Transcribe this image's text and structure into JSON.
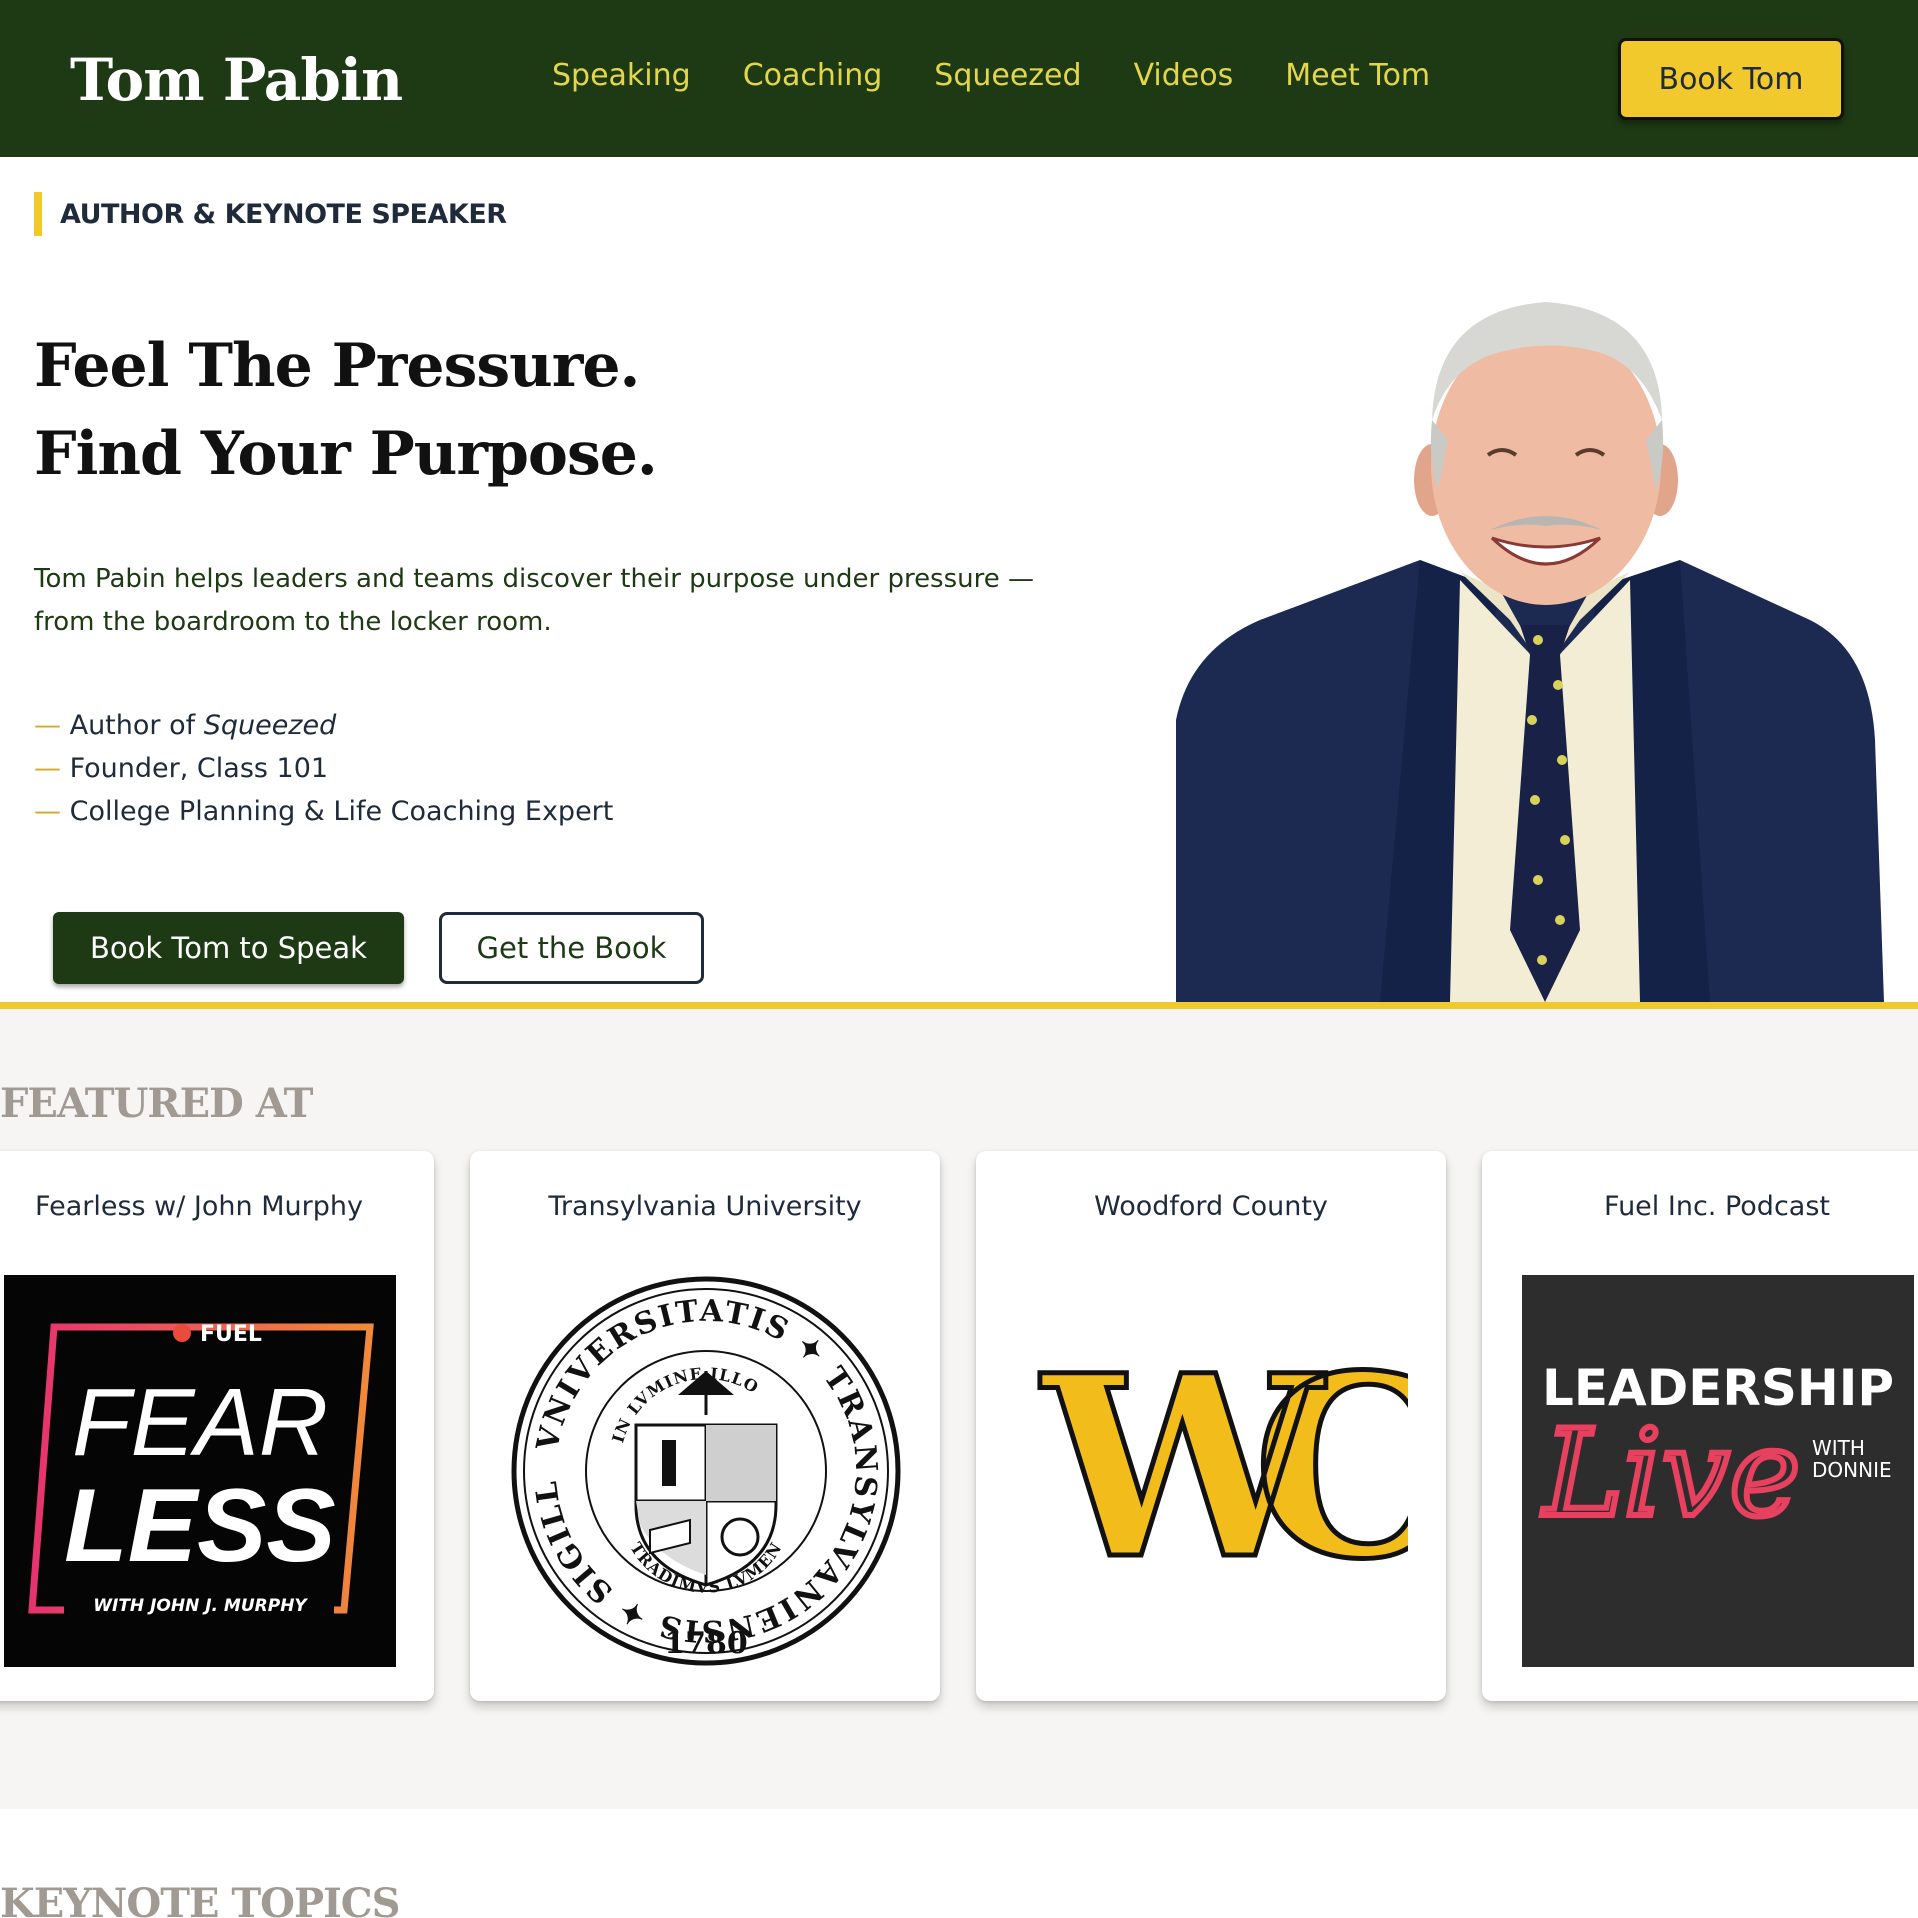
{
  "brand": "Tom Pabin",
  "nav": {
    "links": [
      "Speaking",
      "Coaching",
      "Squeezed",
      "Videos",
      "Meet Tom"
    ],
    "cta": "Book Tom"
  },
  "hero": {
    "eyebrow": "AUTHOR & KEYNOTE SPEAKER",
    "headline_line1": "Feel The Pressure.",
    "headline_line2": "Find Your Purpose.",
    "intro": "Tom Pabin helps leaders and teams discover their purpose under pressure — from the boardroom to the locker room.",
    "credentials": [
      {
        "prefix": "Author of ",
        "emph": "Squeezed"
      },
      {
        "prefix": "Founder, Class 101",
        "emph": ""
      },
      {
        "prefix": "College Planning & Life Coaching Expert",
        "emph": ""
      }
    ],
    "dash": "—",
    "primary_button": "Book Tom to Speak",
    "secondary_button": "Get the Book"
  },
  "featured": {
    "title": "FEATURED AT",
    "cards": [
      {
        "title": "Fearless w/ John Murphy",
        "logo": {
          "top": "FUEL",
          "line1": "FEAR",
          "line2": "LESS",
          "bottom": "WITH JOHN J. MURPHY"
        }
      },
      {
        "title": "Transylvania University",
        "logo": {
          "ring_text": "VNIVERSITATIS ✦ TRANSYLVANIENSIS ✦ SIGILLVM ✦",
          "inner_top": "IN LVMINE ILLO",
          "inner_bottom": "TRADIMVS LVMEN",
          "year": "1780"
        }
      },
      {
        "title": "Woodford County",
        "logo": {
          "letters": "WC"
        }
      },
      {
        "title": "Fuel Inc. Podcast",
        "logo": {
          "line1": "LEADERSHIP",
          "script": "Live",
          "with": "WITH",
          "name": "DONNIE"
        }
      }
    ]
  },
  "keynote": {
    "title": "KEYNOTE TOPICS"
  },
  "colors": {
    "nav_bg": "#1e3a14",
    "accent_yellow": "#f2c92c",
    "nav_link": "#e3d64a",
    "dark_green": "#1e3a14",
    "muted_heading": "#a19a93"
  }
}
